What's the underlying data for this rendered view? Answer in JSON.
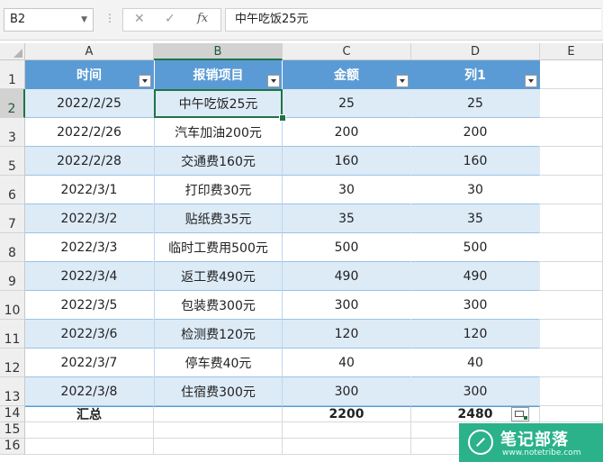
{
  "formula_bar": {
    "name_box": "B2",
    "cancel_icon": "✕",
    "enter_icon": "✓",
    "fx_label": "fx",
    "formula": "中午吃饭25元"
  },
  "columns": [
    "A",
    "B",
    "C",
    "D",
    "E"
  ],
  "table": {
    "headers": [
      "时间",
      "报销项目",
      "金额",
      "列1"
    ],
    "rows": [
      {
        "row_num": "2",
        "date": "2022/2/25",
        "item": "中午吃饭25元",
        "amount": "25",
        "col1": "25"
      },
      {
        "row_num": "3",
        "date": "2022/2/26",
        "item": "汽车加油200元",
        "amount": "200",
        "col1": "200"
      },
      {
        "row_num": "5",
        "date": "2022/2/28",
        "item": "交通费160元",
        "amount": "160",
        "col1": "160"
      },
      {
        "row_num": "6",
        "date": "2022/3/1",
        "item": "打印费30元",
        "amount": "30",
        "col1": "30"
      },
      {
        "row_num": "7",
        "date": "2022/3/2",
        "item": "贴纸费35元",
        "amount": "35",
        "col1": "35"
      },
      {
        "row_num": "8",
        "date": "2022/3/3",
        "item": "临时工费用500元",
        "amount": "500",
        "col1": "500"
      },
      {
        "row_num": "9",
        "date": "2022/3/4",
        "item": "返工费490元",
        "amount": "490",
        "col1": "490"
      },
      {
        "row_num": "10",
        "date": "2022/3/5",
        "item": "包装费300元",
        "amount": "300",
        "col1": "300"
      },
      {
        "row_num": "11",
        "date": "2022/3/6",
        "item": "检测费120元",
        "amount": "120",
        "col1": "120"
      },
      {
        "row_num": "12",
        "date": "2022/3/7",
        "item": "停车费40元",
        "amount": "40",
        "col1": "40"
      },
      {
        "row_num": "13",
        "date": "2022/3/8",
        "item": "住宿费300元",
        "amount": "300",
        "col1": "300"
      }
    ],
    "header_row_num": "1",
    "total": {
      "row_num": "14",
      "label": "汇总",
      "amount": "2200",
      "col1": "2480"
    },
    "empty_rows": [
      "15",
      "16"
    ]
  },
  "selected_cell": "B2",
  "colors": {
    "header_fill": "#5b9bd5",
    "band_fill": "#ddebf7",
    "selection": "#217346"
  },
  "watermark": {
    "title": "笔记部落",
    "url": "www.notetribe.com"
  }
}
